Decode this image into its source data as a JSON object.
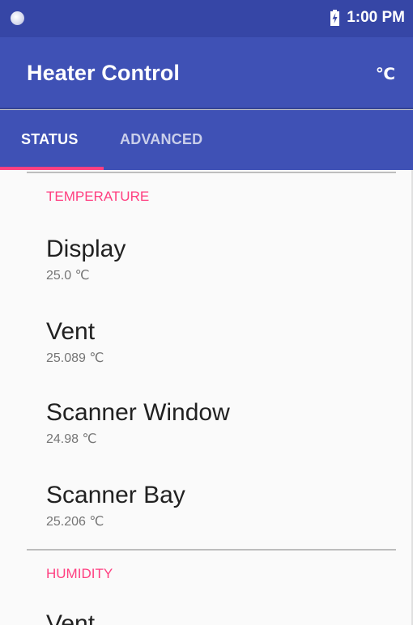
{
  "status_bar": {
    "time": "1:00 PM",
    "notification_icon": "circle-notification-icon",
    "battery_icon": "battery-charging-icon"
  },
  "app_bar": {
    "title": "Heater Control",
    "unit_action": "℃"
  },
  "tabs": [
    {
      "label": "STATUS",
      "selected": true
    },
    {
      "label": "ADVANCED",
      "selected": false
    }
  ],
  "sections": [
    {
      "header": "TEMPERATURE",
      "items": [
        {
          "title": "Display",
          "summary": "25.0 ℃"
        },
        {
          "title": "Vent",
          "summary": "25.089 ℃"
        },
        {
          "title": "Scanner Window",
          "summary": "24.98 ℃"
        },
        {
          "title": "Scanner Bay",
          "summary": "25.206 ℃"
        }
      ]
    },
    {
      "header": "HUMIDITY",
      "items": [
        {
          "title": "Vent"
        }
      ]
    }
  ],
  "colors": {
    "primary": "#3f51b5",
    "primary_dark": "#3646a6",
    "accent": "#ff4081",
    "background": "#fafafa",
    "text_primary": "#212121",
    "text_secondary": "#757575"
  }
}
